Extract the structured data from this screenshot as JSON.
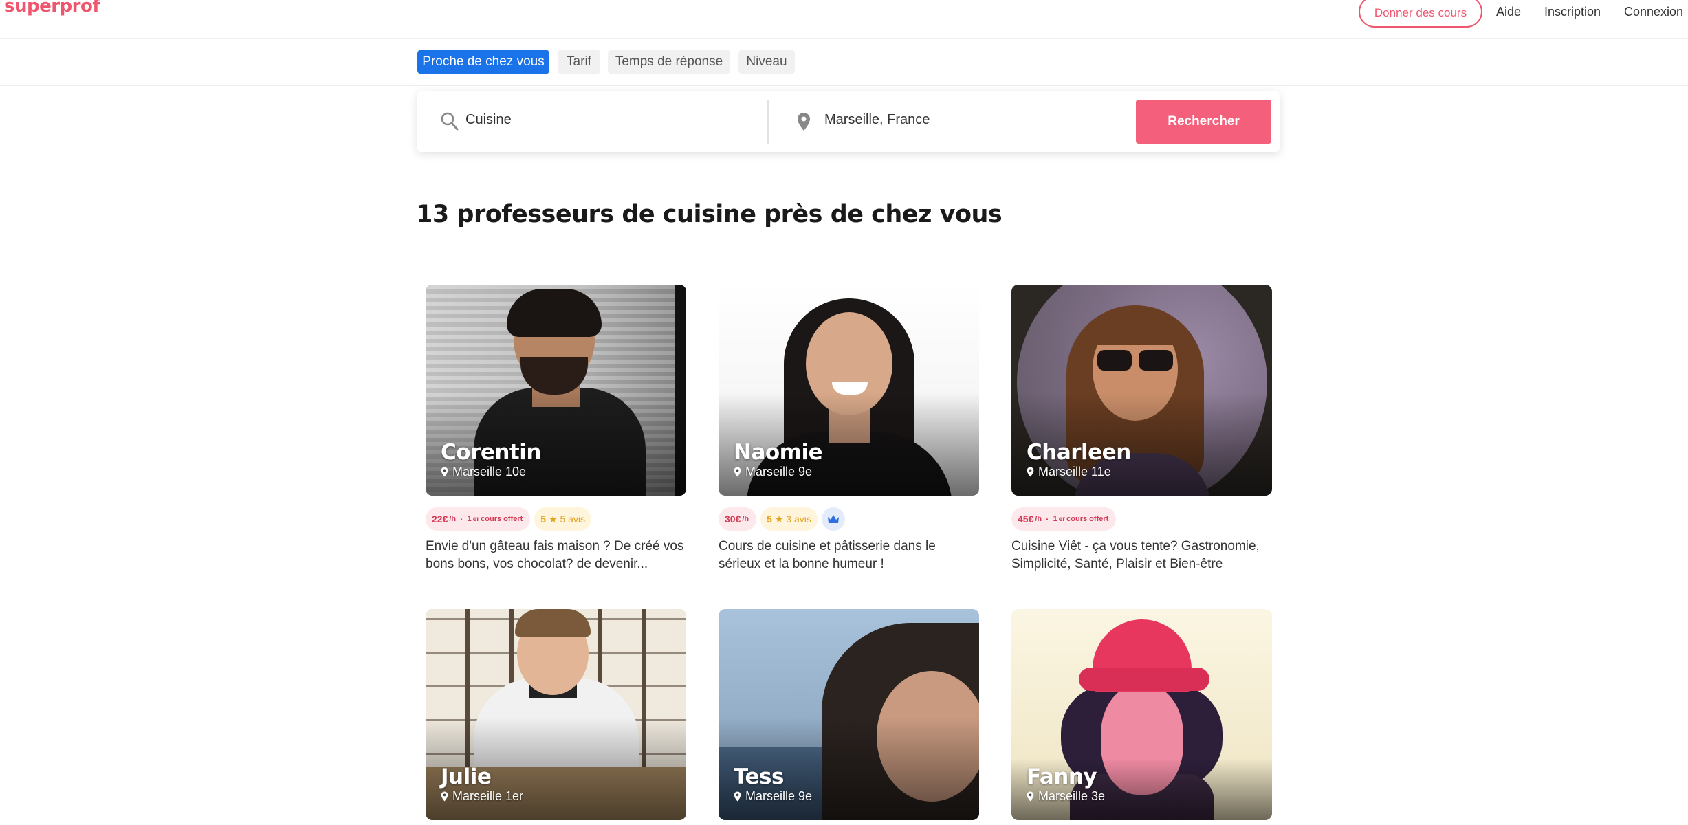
{
  "header": {
    "logo": "superprof",
    "give_lessons": "Donner des cours",
    "help": "Aide",
    "signup": "Inscription",
    "login": "Connexion"
  },
  "filters": [
    {
      "label": "Proche de chez vous",
      "active": true
    },
    {
      "label": "Tarif",
      "active": false
    },
    {
      "label": "Temps de réponse",
      "active": false
    },
    {
      "label": "Niveau",
      "active": false
    }
  ],
  "search": {
    "subject": "Cuisine",
    "location": "Marseille, France",
    "button": "Rechercher"
  },
  "title": "13 professeurs de cuisine près de chez vous",
  "colors": {
    "brand": "#f0556e",
    "search_button": "#f45f7c",
    "active_filter": "#1a73e8"
  },
  "teachers": [
    {
      "name": "Corentin",
      "location": "Marseille 10e",
      "price": "22€",
      "per_hour": "/h",
      "first_lesson": [
        "1",
        "er",
        " cours offert"
      ],
      "rating": "5",
      "reviews": "5 avis",
      "description": "Envie d'un gâteau fais maison ? De créé vos bons bons, vos chocolat? de devenir..."
    },
    {
      "name": "Naomie",
      "location": "Marseille 9e",
      "price": "30€",
      "per_hour": "/h",
      "rating": "5",
      "reviews": "3 avis",
      "ambassador_icon": "crown-icon",
      "description": "Cours de cuisine et pâtisserie dans le sérieux et la bonne humeur !"
    },
    {
      "name": "Charleen",
      "location": "Marseille 11e",
      "price": "45€",
      "per_hour": "/h",
      "first_lesson": [
        "1",
        "er",
        " cours offert"
      ],
      "description": "Cuisine Viêt - ça vous tente? Gastronomie, Simplicité, Santé, Plaisir et Bien-être"
    },
    {
      "name": "Julie",
      "location": "Marseille 1er"
    },
    {
      "name": "Tess",
      "location": "Marseille 9e"
    },
    {
      "name": "Fanny",
      "location": "Marseille 3e"
    }
  ]
}
